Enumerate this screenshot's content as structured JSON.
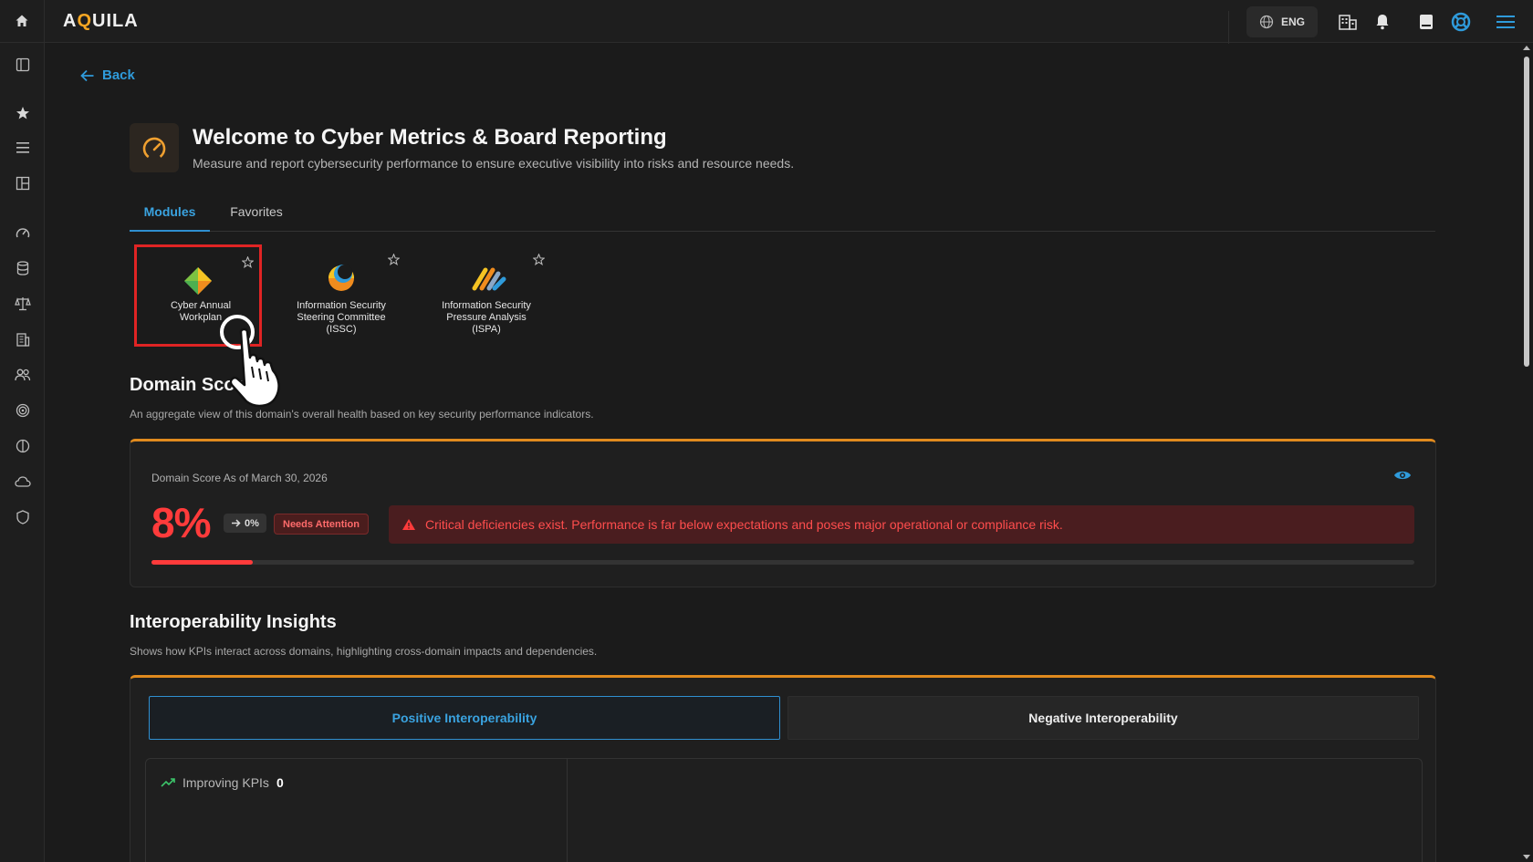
{
  "app": {
    "logo_prefix": "A",
    "logo_accent": "Q",
    "logo_suffix": "UILA",
    "language": "ENG"
  },
  "nav": {
    "back_label": "Back"
  },
  "header": {
    "title": "Welcome to Cyber Metrics & Board Reporting",
    "subtitle": "Measure and report cybersecurity performance to ensure executive visibility into risks and resource needs."
  },
  "tabs": {
    "modules": "Modules",
    "favorites": "Favorites"
  },
  "modules": [
    {
      "label_line1": "Cyber Annual",
      "label_line2": "Workplan",
      "label_line3": "",
      "icon": "diamond-icon",
      "selected": true
    },
    {
      "label_line1": "Information Security",
      "label_line2": "Steering Committee",
      "label_line3": "(ISSC)",
      "icon": "crescent-icon",
      "selected": false
    },
    {
      "label_line1": "Information Security",
      "label_line2": "Pressure Analysis",
      "label_line3": "(ISPA)",
      "icon": "stripes-icon",
      "selected": false
    }
  ],
  "domain_score": {
    "title": "Domain Score",
    "description": "An aggregate view of this domain's overall health based on key security performance indicators.",
    "as_of": "Domain Score As of March 30, 2026",
    "value": "8%",
    "trend": "0%",
    "status": "Needs Attention",
    "alert": "Critical deficiencies exist. Performance is far below expectations and poses major operational or compliance risk.",
    "progress_percent": 8
  },
  "interop": {
    "title": "Interoperability Insights",
    "description": "Shows how KPIs interact across domains, highlighting cross-domain impacts and dependencies.",
    "positive_tab": "Positive Interoperability",
    "negative_tab": "Negative Interoperability",
    "improving_label": "Improving KPIs",
    "improving_count": "0"
  },
  "colors": {
    "accent_blue": "#2f9bdb",
    "accent_orange": "#e08a1e",
    "danger_red": "#ff3b3b"
  }
}
